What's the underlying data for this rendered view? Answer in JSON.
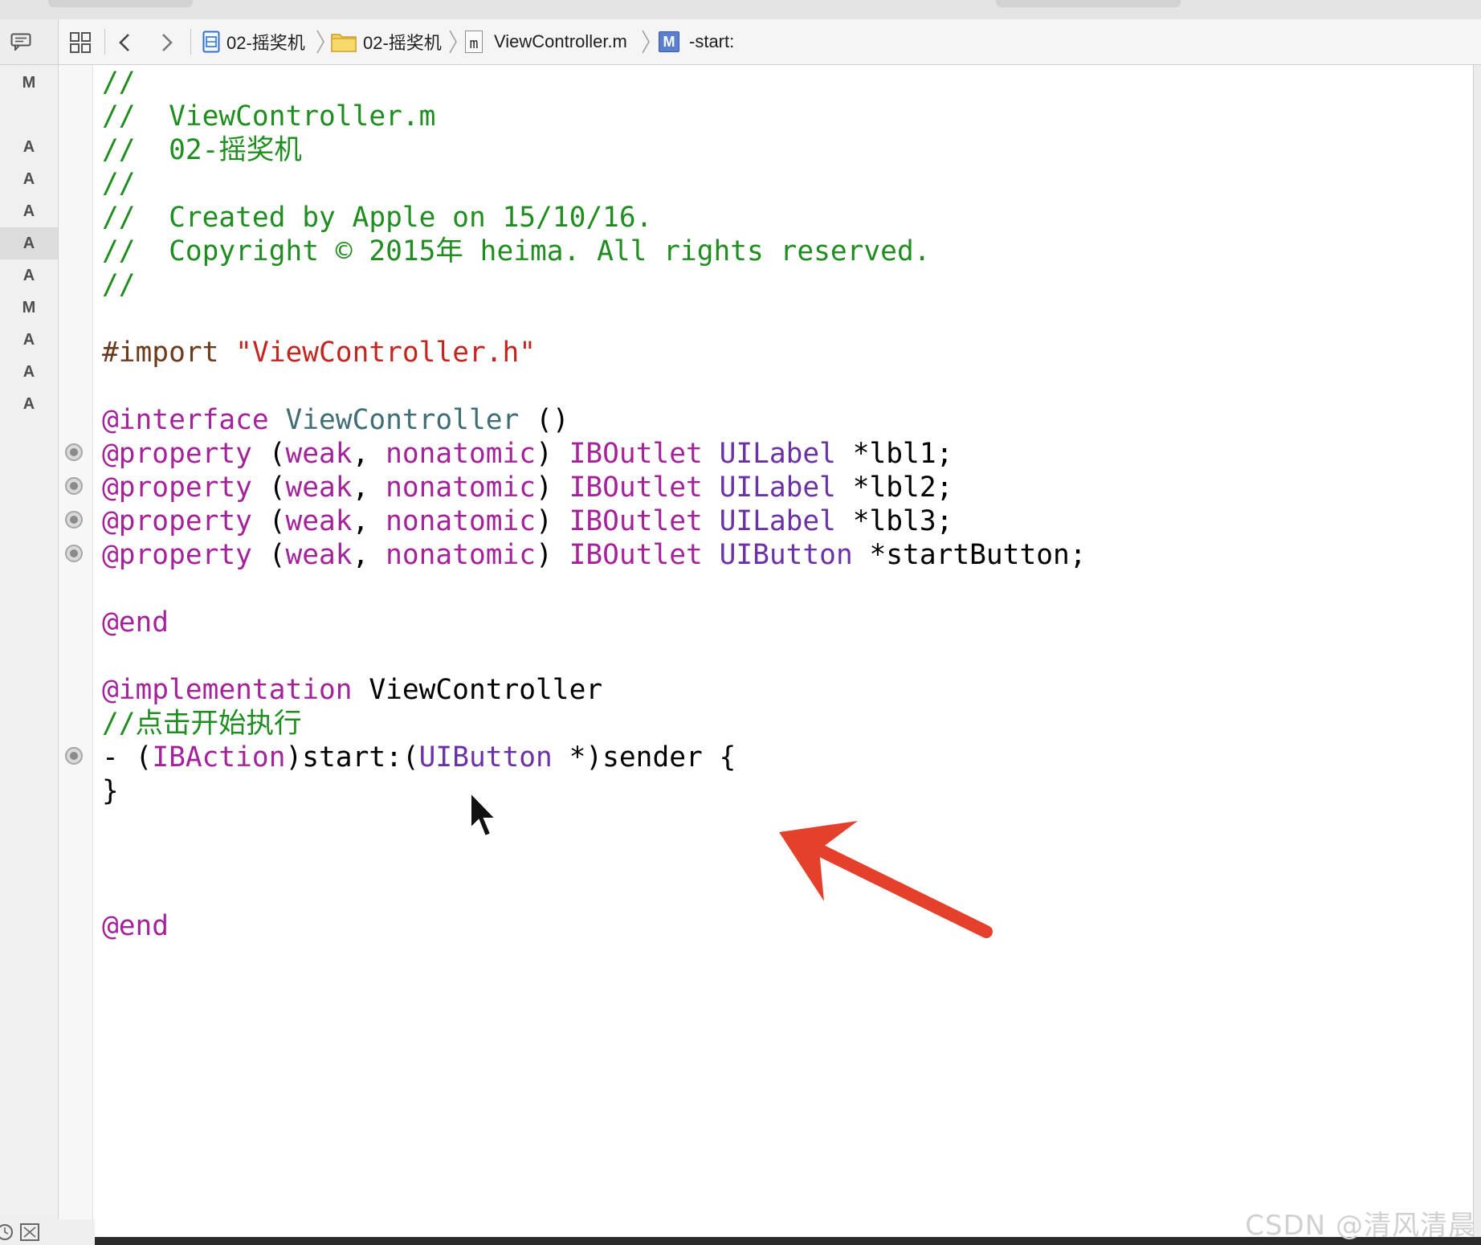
{
  "breadcrumb": {
    "items": [
      {
        "label": "02-摇奖机",
        "icon": "project-icon"
      },
      {
        "label": "02-摇奖机",
        "icon": "folder-icon"
      },
      {
        "label": "ViewController.m",
        "icon": "objc-file-icon",
        "icon_text": "m"
      },
      {
        "label": "-start:",
        "icon": "method-icon",
        "icon_text": "M"
      }
    ]
  },
  "source_control_status": [
    "M",
    "A",
    "A",
    "A",
    "A",
    "A",
    "M",
    "A",
    "A",
    "A"
  ],
  "code_lines": [
    {
      "segments": [
        {
          "t": "//",
          "c": "cm"
        }
      ]
    },
    {
      "segments": [
        {
          "t": "//  ViewController.m",
          "c": "cm"
        }
      ]
    },
    {
      "segments": [
        {
          "t": "//  02-摇奖机",
          "c": "cm"
        }
      ]
    },
    {
      "segments": [
        {
          "t": "//",
          "c": "cm"
        }
      ]
    },
    {
      "segments": [
        {
          "t": "//  Created by Apple on 15/10/16.",
          "c": "cm"
        }
      ]
    },
    {
      "segments": [
        {
          "t": "//  Copyright © 2015年 heima. All rights reserved.",
          "c": "cm"
        }
      ]
    },
    {
      "segments": [
        {
          "t": "//",
          "c": "cm"
        }
      ]
    },
    {
      "segments": []
    },
    {
      "segments": [
        {
          "t": "#import ",
          "c": "pp"
        },
        {
          "t": "\"ViewController.h\"",
          "c": "str"
        }
      ]
    },
    {
      "segments": []
    },
    {
      "segments": [
        {
          "t": "@interface",
          "c": "kw"
        },
        {
          "t": " "
        },
        {
          "t": "ViewController",
          "c": "cls"
        },
        {
          "t": " ()"
        }
      ]
    },
    {
      "bp": true,
      "segments": [
        {
          "t": "@property",
          "c": "kw"
        },
        {
          "t": " ("
        },
        {
          "t": "weak",
          "c": "kw"
        },
        {
          "t": ", "
        },
        {
          "t": "nonatomic",
          "c": "kw"
        },
        {
          "t": ") "
        },
        {
          "t": "IBOutlet",
          "c": "kw"
        },
        {
          "t": " "
        },
        {
          "t": "UILabel",
          "c": "ty"
        },
        {
          "t": " *lbl1;"
        }
      ]
    },
    {
      "bp": true,
      "segments": [
        {
          "t": "@property",
          "c": "kw"
        },
        {
          "t": " ("
        },
        {
          "t": "weak",
          "c": "kw"
        },
        {
          "t": ", "
        },
        {
          "t": "nonatomic",
          "c": "kw"
        },
        {
          "t": ") "
        },
        {
          "t": "IBOutlet",
          "c": "kw"
        },
        {
          "t": " "
        },
        {
          "t": "UILabel",
          "c": "ty"
        },
        {
          "t": " *lbl2;"
        }
      ]
    },
    {
      "bp": true,
      "segments": [
        {
          "t": "@property",
          "c": "kw"
        },
        {
          "t": " ("
        },
        {
          "t": "weak",
          "c": "kw"
        },
        {
          "t": ", "
        },
        {
          "t": "nonatomic",
          "c": "kw"
        },
        {
          "t": ") "
        },
        {
          "t": "IBOutlet",
          "c": "kw"
        },
        {
          "t": " "
        },
        {
          "t": "UILabel",
          "c": "ty"
        },
        {
          "t": " *lbl3;"
        }
      ]
    },
    {
      "bp": true,
      "segments": [
        {
          "t": "@property",
          "c": "kw"
        },
        {
          "t": " ("
        },
        {
          "t": "weak",
          "c": "kw"
        },
        {
          "t": ", "
        },
        {
          "t": "nonatomic",
          "c": "kw"
        },
        {
          "t": ") "
        },
        {
          "t": "IBOutlet",
          "c": "kw"
        },
        {
          "t": " "
        },
        {
          "t": "UIButton",
          "c": "ty"
        },
        {
          "t": " *startButton;"
        }
      ]
    },
    {
      "segments": []
    },
    {
      "segments": [
        {
          "t": "@end",
          "c": "kw"
        }
      ]
    },
    {
      "segments": []
    },
    {
      "segments": [
        {
          "t": "@implementation",
          "c": "kw"
        },
        {
          "t": " ViewController"
        }
      ]
    },
    {
      "segments": [
        {
          "t": "//点击开始执行",
          "c": "cm"
        }
      ]
    },
    {
      "bp": true,
      "segments": [
        {
          "t": "- ("
        },
        {
          "t": "IBAction",
          "c": "kw"
        },
        {
          "t": ")start:("
        },
        {
          "t": "UIButton",
          "c": "ty"
        },
        {
          "t": " *)sender {"
        }
      ]
    },
    {
      "segments": [
        {
          "t": "}"
        }
      ]
    },
    {
      "segments": []
    },
    {
      "segments": []
    },
    {
      "segments": []
    },
    {
      "segments": [
        {
          "t": "@end",
          "c": "kw"
        }
      ]
    }
  ],
  "watermark": "CSDN @清风清晨",
  "colors": {
    "comment": "#1f8d1f",
    "keyword": "#a4239a",
    "string": "#c2261f",
    "preprocessor": "#6c3a1c",
    "class": "#3f6e74",
    "type": "#6b32a6",
    "annotation_arrow": "#e5402b"
  }
}
